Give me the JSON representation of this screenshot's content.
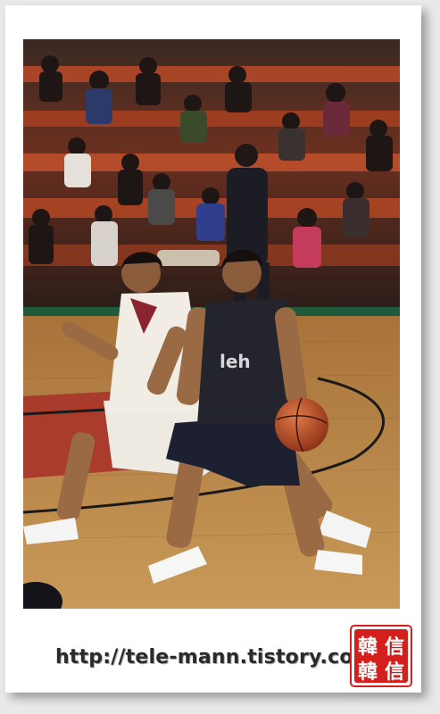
{
  "photo": {
    "subject": "basketball-game",
    "colors": {
      "stands": "#c2512c",
      "court": "#b8843e",
      "paint": "#a8342a",
      "home_jersey": "#f1ece4",
      "away_jersey": "#23242c",
      "ball": "#c5502a"
    }
  },
  "caption": {
    "url": "http://tele-mann.tistory.com"
  },
  "seal": {
    "color": "#d4201d",
    "text": "韓信"
  }
}
